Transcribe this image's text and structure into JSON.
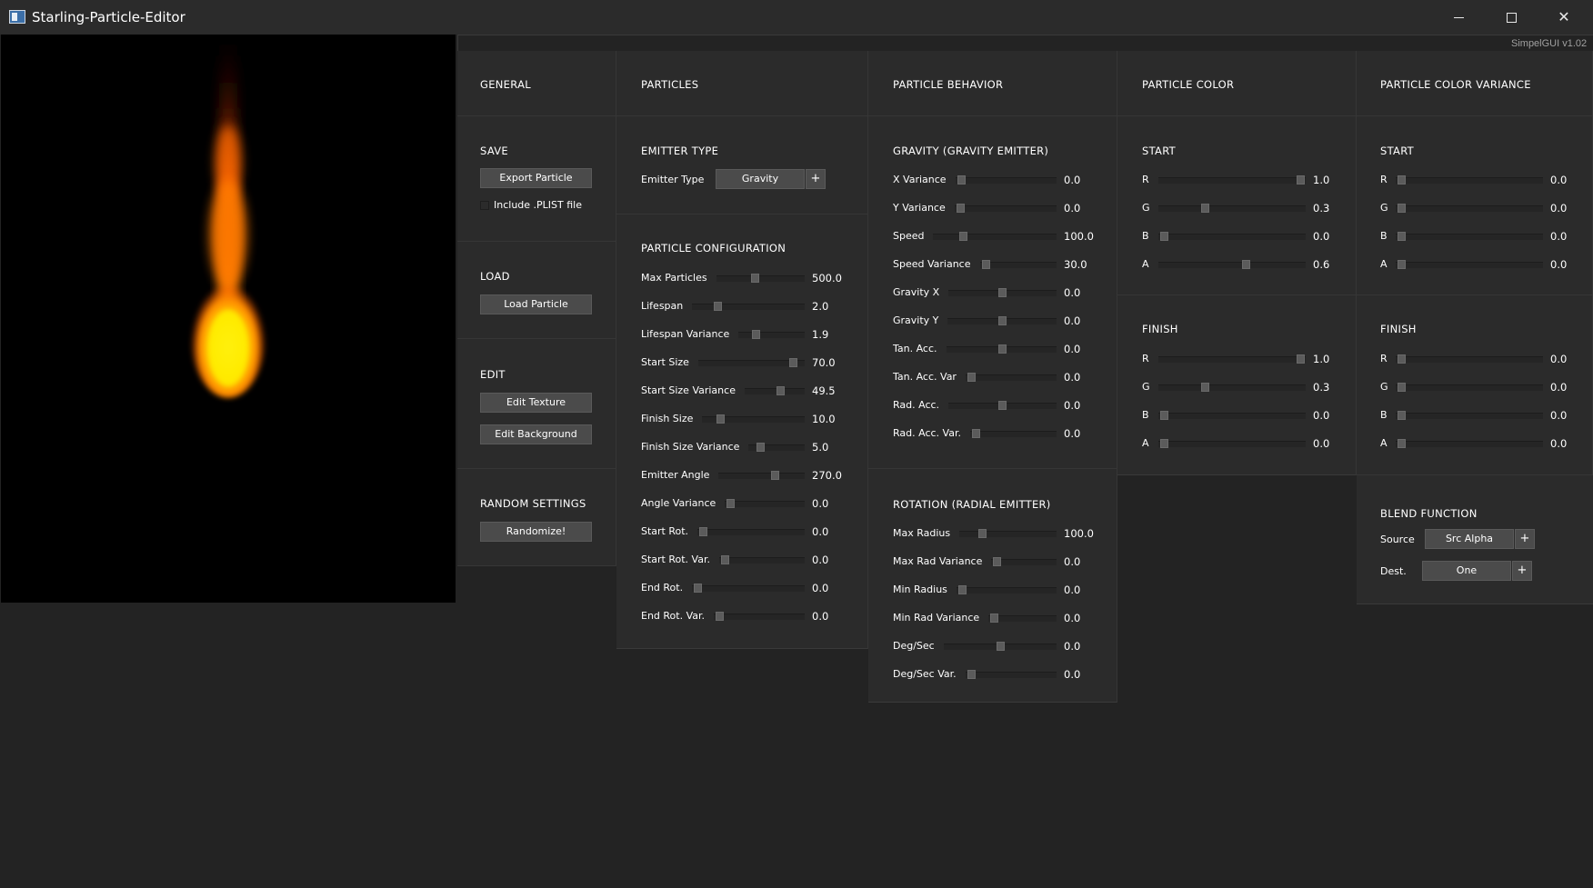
{
  "window": {
    "title": "Starling-Particle-Editor",
    "controls": {
      "minimize": "minimize",
      "maximize": "maximize",
      "close": "✕"
    }
  },
  "version_label": "SimpelGUI v1.02",
  "general": {
    "heading": "GENERAL",
    "save": {
      "heading": "SAVE",
      "export_button": "Export Particle",
      "include_plist_label": "Include .PLIST file",
      "include_plist_checked": false
    },
    "load": {
      "heading": "LOAD",
      "load_button": "Load Particle"
    },
    "edit": {
      "heading": "EDIT",
      "edit_texture_button": "Edit Texture",
      "edit_background_button": "Edit Background"
    },
    "random": {
      "heading": "RANDOM SETTINGS",
      "randomize_button": "Randomize!"
    }
  },
  "particles": {
    "heading": "PARTICLES",
    "emitter": {
      "heading": "EMITTER TYPE",
      "label": "Emitter Type",
      "value": "Gravity",
      "plus": "+"
    },
    "config": {
      "heading": "PARTICLE CONFIGURATION",
      "rows": [
        {
          "label": "Max Particles",
          "value": "500.0",
          "level": 0.42
        },
        {
          "label": "Lifespan",
          "value": "2.0",
          "level": 0.2
        },
        {
          "label": "Lifespan Variance",
          "value": "1.9",
          "level": 0.22
        },
        {
          "label": "Start Size",
          "value": "70.0",
          "level": 0.93
        },
        {
          "label": "Start Size Variance",
          "value": "49.5",
          "level": 0.62
        },
        {
          "label": "Finish Size",
          "value": "10.0",
          "level": 0.14
        },
        {
          "label": "Finish Size Variance",
          "value": "5.0",
          "level": 0.14
        },
        {
          "label": "Emitter Angle",
          "value": "270.0",
          "level": 0.68
        },
        {
          "label": "Angle Variance",
          "value": "0.0",
          "level": 0.0
        },
        {
          "label": "Start Rot.",
          "value": "0.0",
          "level": 0.0
        },
        {
          "label": "Start Rot. Var.",
          "value": "0.0",
          "level": 0.0
        },
        {
          "label": "End Rot.",
          "value": "0.0",
          "level": 0.0
        },
        {
          "label": "End Rot. Var.",
          "value": "0.0",
          "level": 0.0
        }
      ]
    }
  },
  "behavior": {
    "heading": "PARTICLE BEHAVIOR",
    "gravity": {
      "heading": "GRAVITY (GRAVITY EMITTER)",
      "rows": [
        {
          "label": "X Variance",
          "value": "0.0",
          "level": 0.0
        },
        {
          "label": "Y Variance",
          "value": "0.0",
          "level": 0.0
        },
        {
          "label": "Speed",
          "value": "100.0",
          "level": 0.22
        },
        {
          "label": "Speed Variance",
          "value": "30.0",
          "level": 0.0
        },
        {
          "label": "Gravity X",
          "value": "0.0",
          "level": 0.5
        },
        {
          "label": "Gravity Y",
          "value": "0.0",
          "level": 0.5
        },
        {
          "label": "Tan. Acc.",
          "value": "0.0",
          "level": 0.5
        },
        {
          "label": "Tan. Acc. Var",
          "value": "0.0",
          "level": 0.0
        },
        {
          "label": "Rad. Acc.",
          "value": "0.0",
          "level": 0.5
        },
        {
          "label": "Rad. Acc. Var.",
          "value": "0.0",
          "level": 0.0
        }
      ]
    },
    "rotation": {
      "heading": "ROTATION (RADIAL EMITTER)",
      "rows": [
        {
          "label": "Max Radius",
          "value": "100.0",
          "level": 0.2
        },
        {
          "label": "Max Rad Variance",
          "value": "0.0",
          "level": 0.0
        },
        {
          "label": "Min Radius",
          "value": "0.0",
          "level": 0.0
        },
        {
          "label": "Min Rad Variance",
          "value": "0.0",
          "level": 0.0
        },
        {
          "label": "Deg/Sec",
          "value": "0.0",
          "level": 0.5
        },
        {
          "label": "Deg/Sec Var.",
          "value": "0.0",
          "level": 0.0
        }
      ]
    }
  },
  "color": {
    "heading": "PARTICLE COLOR",
    "start": {
      "heading": "START",
      "rows": [
        {
          "label": "R",
          "value": "1.0",
          "level": 1.0
        },
        {
          "label": "G",
          "value": "0.3",
          "level": 0.3
        },
        {
          "label": "B",
          "value": "0.0",
          "level": 0.0
        },
        {
          "label": "A",
          "value": "0.6",
          "level": 0.6
        }
      ]
    },
    "finish": {
      "heading": "FINISH",
      "rows": [
        {
          "label": "R",
          "value": "1.0",
          "level": 1.0
        },
        {
          "label": "G",
          "value": "0.3",
          "level": 0.3
        },
        {
          "label": "B",
          "value": "0.0",
          "level": 0.0
        },
        {
          "label": "A",
          "value": "0.0",
          "level": 0.0
        }
      ]
    }
  },
  "variance": {
    "heading": "PARTICLE COLOR VARIANCE",
    "start": {
      "heading": "START",
      "rows": [
        {
          "label": "R",
          "value": "0.0",
          "level": 0.0
        },
        {
          "label": "G",
          "value": "0.0",
          "level": 0.0
        },
        {
          "label": "B",
          "value": "0.0",
          "level": 0.0
        },
        {
          "label": "A",
          "value": "0.0",
          "level": 0.0
        }
      ]
    },
    "finish": {
      "heading": "FINISH",
      "rows": [
        {
          "label": "R",
          "value": "0.0",
          "level": 0.0
        },
        {
          "label": "G",
          "value": "0.0",
          "level": 0.0
        },
        {
          "label": "B",
          "value": "0.0",
          "level": 0.0
        },
        {
          "label": "A",
          "value": "0.0",
          "level": 0.0
        }
      ]
    },
    "blend": {
      "heading": "BLEND FUNCTION",
      "source_label": "Source",
      "source_value": "Src Alpha",
      "dest_label": "Dest.",
      "dest_value": "One",
      "plus": "+"
    }
  },
  "colors": {
    "window_bg": "#232323",
    "panel_bg": "#2b2b2b",
    "button_bg": "#4b4b4b",
    "slider_track": "#252525",
    "slider_thumb": "#5b5b5b",
    "preview_bg": "#000000",
    "flame_core": "#ffee00",
    "flame_edge": "#ff6a00"
  },
  "icons": {
    "app": "app-window-icon",
    "minimize": "minimize-icon",
    "maximize": "maximize-icon",
    "close": "close-icon"
  }
}
